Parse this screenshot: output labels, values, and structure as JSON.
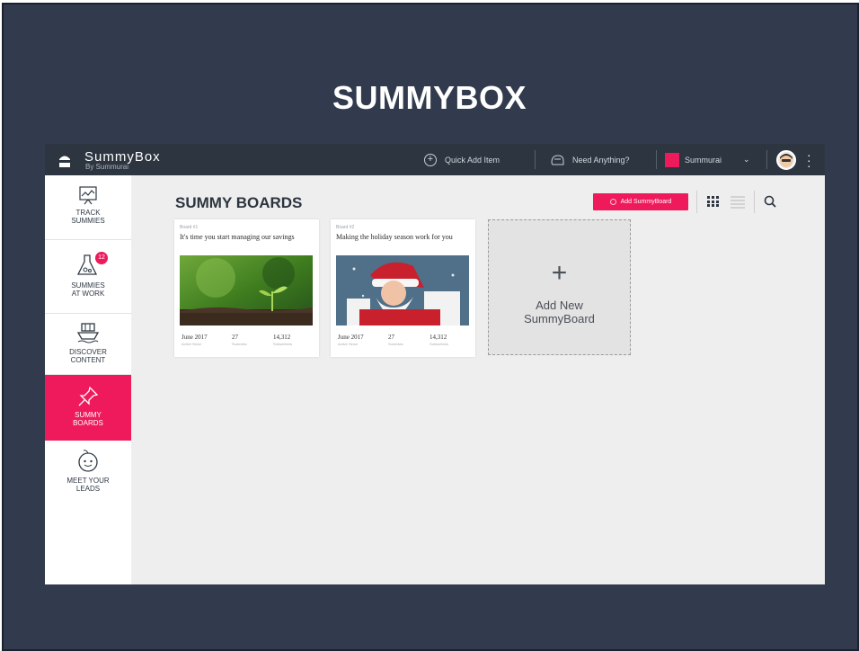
{
  "slide": {
    "title": "SUMMYBOX"
  },
  "topbar": {
    "logo_name": "SummyBox",
    "logo_sub": "By Summurai",
    "quick_add_label": "Quick Add Item",
    "need_anything_label": "Need Anything?",
    "account_label": "Summurai"
  },
  "sidebar": {
    "items": [
      {
        "label_line1": "TRACK",
        "label_line2": "SUMMIES",
        "icon": "chart-icon"
      },
      {
        "label_line1": "SUMMIES",
        "label_line2": "AT WORK",
        "icon": "flask-icon",
        "badge": "12"
      },
      {
        "label_line1": "DISCOVER",
        "label_line2": "CONTENT",
        "icon": "ship-icon"
      },
      {
        "label_line1": "SUMMY",
        "label_line2": "BOARDS",
        "icon": "pin-icon",
        "active": true
      },
      {
        "label_line1": "MEET YOUR",
        "label_line2": "LEADS",
        "icon": "face-icon"
      }
    ]
  },
  "main": {
    "title": "SUMMY BOARDS",
    "add_button_label": "Add SummyBoard",
    "boards": [
      {
        "number": "Board #1",
        "title": "It's time you start managing our savings",
        "date": "June 2017",
        "date_label": "Active Since",
        "summies": "27",
        "summies_label": "Summies",
        "subscribers": "14,312",
        "subscribers_label": "Subscribers"
      },
      {
        "number": "Board #2",
        "title": "Making the holiday season work for you",
        "date": "June 2017",
        "date_label": "Active Since",
        "summies": "27",
        "summies_label": "Summies",
        "subscribers": "14,312",
        "subscribers_label": "Subscribers"
      }
    ],
    "new_board": {
      "plus": "+",
      "line1": "Add New",
      "line2": "SummyBoard"
    }
  },
  "colors": {
    "accent": "#ee1a5b",
    "topbar": "#2d3540",
    "slide_bg": "#323b4e"
  }
}
